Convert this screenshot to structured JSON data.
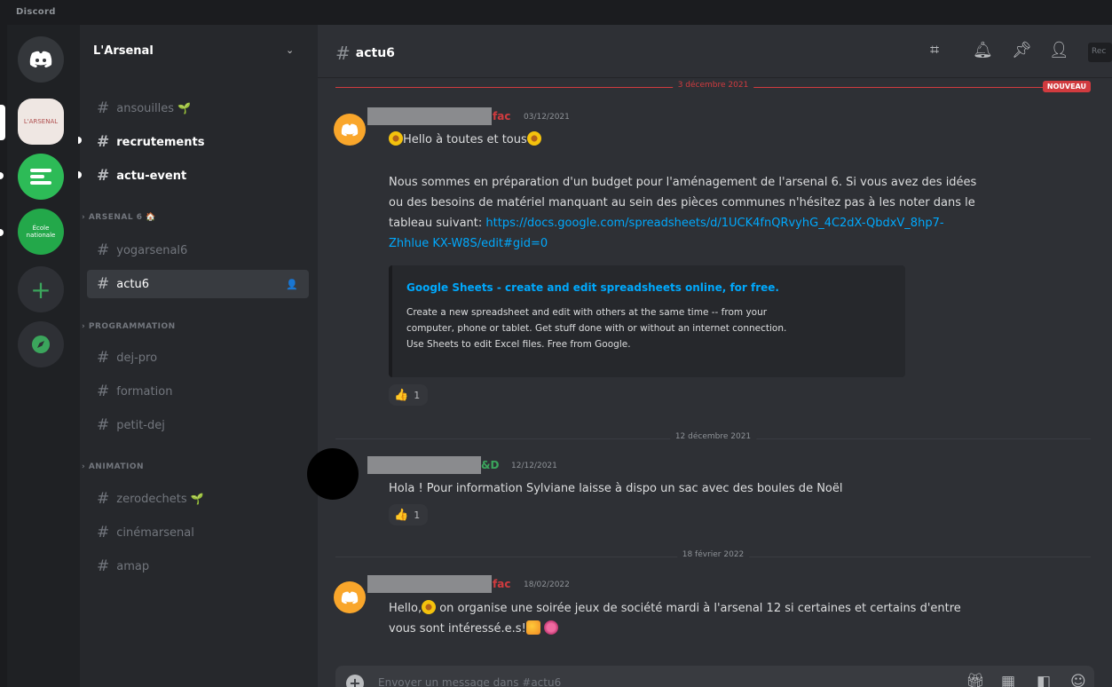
{
  "window": {
    "title": "Discord"
  },
  "servers": [
    {
      "name": "home",
      "icon": "discord-logo-icon"
    },
    {
      "name": "arsenal",
      "text": "L'ARSENAL"
    },
    {
      "name": "green-menu",
      "icon": "bars-icon"
    },
    {
      "name": "ecole-nationale",
      "text": "École nationale"
    },
    {
      "name": "add-server",
      "icon": "plus-icon"
    },
    {
      "name": "explore",
      "icon": "compass-icon"
    }
  ],
  "sidebar": {
    "guild_name": "L'Arsenal",
    "chevron": "⌄",
    "channels_top": [
      {
        "label": "ansouilles",
        "sprout": true
      },
      {
        "label": "recrutements",
        "unread": true
      },
      {
        "label": "actu-event",
        "unread": true
      }
    ],
    "categories": [
      {
        "label": "ARSENAL 6 🏠",
        "channels": [
          "yogarsenal6",
          "actu6"
        ]
      },
      {
        "label": "PROGRAMMATION",
        "channels": [
          "dej-pro",
          "formation",
          "petit-dej"
        ]
      },
      {
        "label": "ANIMATION",
        "channels": [
          "zerodechets",
          "cinémarsenal",
          "amap"
        ]
      }
    ]
  },
  "header": {
    "channel": "actu6",
    "search_placeholder": "Rec"
  },
  "messages": [
    {
      "divider": "3 décembre 2021",
      "new_badge": "NOUVEAU",
      "author_suffix": "fac",
      "author_color": "#d13b3f",
      "timestamp": "03/12/2021",
      "line1": "Hello à toutes et tous",
      "body1": "Nous sommes en préparation d'un budget pour l'aménagement de l'arsenal 6. Si vous avez des idées",
      "body2": "ou des besoins de matériel manquant au sein des pièces communes n'hésitez pas à les noter dans le",
      "body3_prefix": "tableau suivant: ",
      "link1": "https://docs.google.com/spreadsheets/d/1UCK4fnQRvyhG_4C2dX-QbdxV_8hp7-",
      "link2": "Zhhlue KX-W8S/edit#gid=0",
      "embed": {
        "title": "Google Sheets - create and edit spreadsheets online, for free.",
        "desc1": "Create a new spreadsheet and edit with others at the same time -- from your",
        "desc2": "computer, phone or tablet. Get stuff done with or without an internet connection.",
        "desc3": "Use Sheets to edit Excel files. Free from Google."
      },
      "reaction_count": "1"
    },
    {
      "divider": "12 décembre 2021",
      "author_suffix": "&D",
      "author_color": "#3ba55c",
      "timestamp": "12/12/2021",
      "text": "Hola ! Pour information Sylviane laisse à dispo un sac avec des boules de Noël",
      "reaction_count": "1"
    },
    {
      "divider": "18 février 2022",
      "author_suffix": "fac",
      "author_color": "#d13b3f",
      "timestamp": "18/02/2022",
      "line1_a": "Hello,",
      "line1_b": " on organise une soirée jeux de société mardi à l'arsenal 12 si certaines et certains d'entre",
      "line2": "vous sont intéressé.e.s!"
    }
  ],
  "composer": {
    "placeholder": "Envoyer un message dans #actu6"
  }
}
